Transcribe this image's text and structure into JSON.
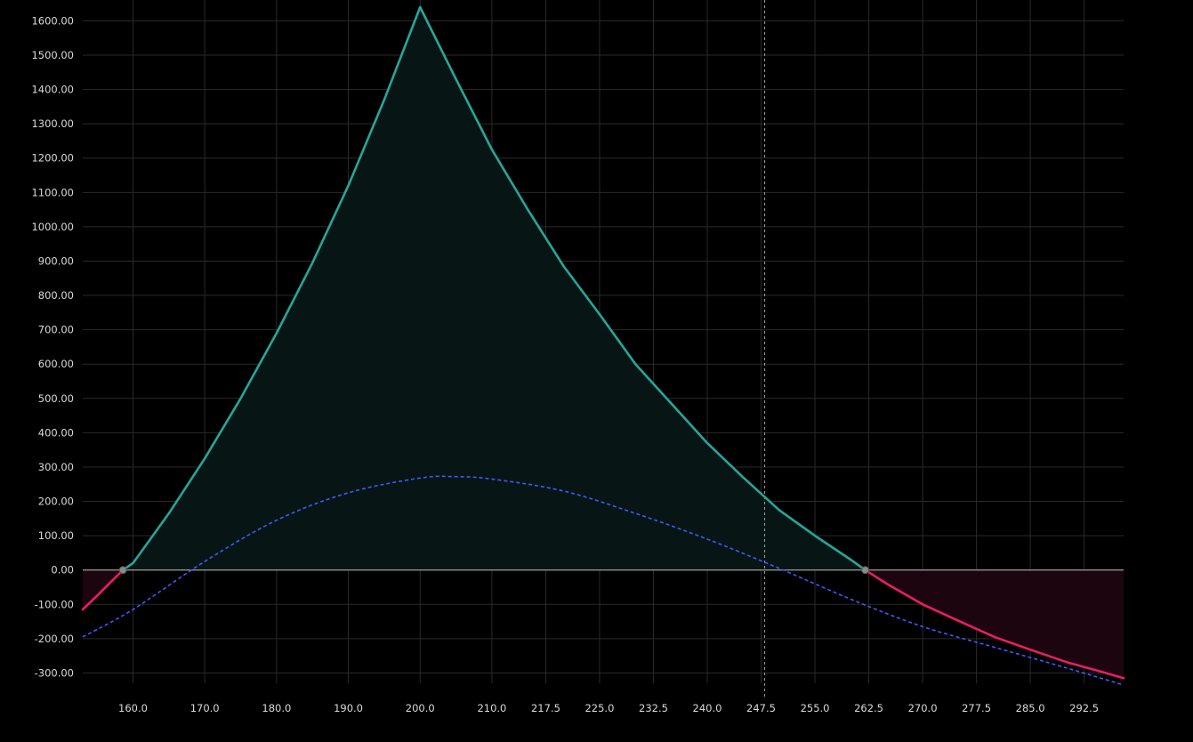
{
  "chart_data": {
    "type": "line",
    "title": "",
    "xlabel": "",
    "ylabel": "",
    "xlim": [
      153,
      298
    ],
    "ylim": [
      -330,
      1640
    ],
    "grid": true,
    "x_ticks": [
      160.0,
      170.0,
      180.0,
      190.0,
      200.0,
      210.0,
      217.5,
      225.0,
      232.5,
      240.0,
      247.5,
      255.0,
      262.5,
      270.0,
      277.5,
      285.0,
      292.5
    ],
    "x_tick_labels": [
      "160.0",
      "170.0",
      "180.0",
      "190.0",
      "200.0",
      "210.0",
      "217.5",
      "225.0",
      "232.5",
      "240.0",
      "247.5",
      "255.0",
      "262.5",
      "270.0",
      "277.5",
      "285.0",
      "292.5"
    ],
    "y_ticks": [
      -300,
      -200,
      -100,
      0,
      100,
      200,
      300,
      400,
      500,
      600,
      700,
      800,
      900,
      1000,
      1100,
      1200,
      1300,
      1400,
      1500,
      1600
    ],
    "y_tick_labels": [
      "-300.00",
      "-200.00",
      "-100.00",
      "0.00",
      "100.00",
      "200.00",
      "300.00",
      "400.00",
      "500.00",
      "600.00",
      "700.00",
      "800.00",
      "900.00",
      "1000.00",
      "1100.00",
      "1200.00",
      "1300.00",
      "1400.00",
      "1500.00",
      "1600.00"
    ],
    "vertical_marker_x": 248.0,
    "breakeven_points": [
      158.6,
      262.0
    ],
    "series": [
      {
        "style": "solid",
        "x": [
          153,
          155,
          158.6,
          160,
          165,
          170,
          175,
          180,
          185,
          190,
          195,
          200,
          205,
          210,
          215,
          220,
          225,
          230,
          235,
          240,
          245,
          250,
          255,
          260,
          262,
          265,
          270,
          275,
          280,
          285,
          290,
          295,
          298
        ],
        "y": [
          -115,
          -75,
          0,
          20,
          165,
          325,
          500,
          690,
          895,
          1120,
          1370,
          1640,
          1430,
          1225,
          1050,
          885,
          745,
          600,
          485,
          370,
          270,
          175,
          100,
          30,
          0,
          -40,
          -100,
          -148,
          -195,
          -232,
          -268,
          -297,
          -315
        ]
      },
      {
        "style": "dashed",
        "x": [
          153,
          160,
          170,
          180,
          190,
          200,
          205,
          210,
          220,
          230,
          240,
          250,
          260,
          270,
          280,
          290,
          298
        ],
        "y": [
          -195,
          -115,
          25,
          145,
          225,
          268,
          272,
          265,
          230,
          165,
          90,
          5,
          -85,
          -165,
          -225,
          -285,
          -335
        ]
      }
    ],
    "colors": {
      "profit_line": "#26a69a",
      "loss_line": "#e91e63",
      "profit_fill": "#071615",
      "loss_fill": "#1d0510",
      "dashed_line": "#3d5afe",
      "grid": "#2a2a2a",
      "zero_line": "#bfbfbf",
      "marker_line": "#9e9e9e",
      "breakeven_dot": "#8a8a8a"
    }
  }
}
